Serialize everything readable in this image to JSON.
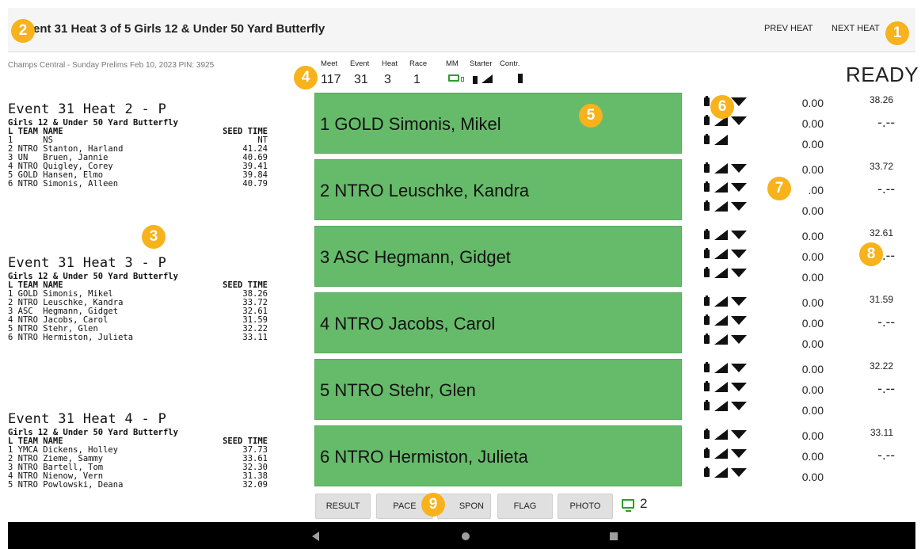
{
  "header": {
    "title": "ent 31 Heat 3 of 5 Girls 12 & Under 50 Yard Butterfly",
    "prev_label": "PREV HEAT",
    "next_label": "NEXT HEAT"
  },
  "meet_info": "Champs Central - Sunday Prelims Feb 10, 2023 PIN: 3925",
  "stats": {
    "labels": [
      "Meet",
      "Event",
      "Heat",
      "Race",
      "MM",
      "Starter",
      "Contr."
    ],
    "meet": "117",
    "event": "31",
    "heat": "3",
    "race": "1"
  },
  "status": "READY",
  "heats": [
    {
      "title": "Event 31 Heat 2 - P",
      "subtitle": "Girls 12 & Under 50 Yard Butterfly",
      "col_left": "L TEAM NAME",
      "col_right": "SEED TIME",
      "rows": [
        {
          "left": "1      NS",
          "right": "NT"
        },
        {
          "left": "2 NTRO Stanton, Harland",
          "right": "41.24"
        },
        {
          "left": "3 UN   Bruen, Jannie",
          "right": "40.69"
        },
        {
          "left": "4 NTRO Quigley, Corey",
          "right": "39.41"
        },
        {
          "left": "5 GOLD Hansen, Elmo",
          "right": "39.84"
        },
        {
          "left": "6 NTRO Simonis, Alleen",
          "right": "40.79"
        }
      ]
    },
    {
      "title": "Event 31 Heat 3 - P",
      "subtitle": "Girls 12 & Under 50 Yard Butterfly",
      "col_left": "L TEAM NAME",
      "col_right": "SEED TIME",
      "rows": [
        {
          "left": "1 GOLD Simonis, Mikel",
          "right": "38.26"
        },
        {
          "left": "2 NTRO Leuschke, Kandra",
          "right": "33.72"
        },
        {
          "left": "3 ASC  Hegmann, Gidget",
          "right": "32.61"
        },
        {
          "left": "4 NTRO Jacobs, Carol",
          "right": "31.59"
        },
        {
          "left": "5 NTRO Stehr, Glen",
          "right": "32.22"
        },
        {
          "left": "6 NTRO Hermiston, Julieta",
          "right": "33.11"
        }
      ]
    },
    {
      "title": "Event 31 Heat 4 - P",
      "subtitle": "Girls 12 & Under 50 Yard Butterfly",
      "col_left": "L TEAM NAME",
      "col_right": "SEED TIME",
      "rows": [
        {
          "left": "1 YMCA Dickens, Holley",
          "right": "37.73"
        },
        {
          "left": "2 NTRO Zieme, Sammy",
          "right": "33.61"
        },
        {
          "left": "3 NTRO Bartell, Tom",
          "right": "32.30"
        },
        {
          "left": "4 NTRO Nienow, Vern",
          "right": "31.38"
        },
        {
          "left": "5 NTRO Powlowski, Deana",
          "right": "32.09"
        }
      ]
    }
  ],
  "lanes": [
    {
      "label": "1  GOLD Simonis, Mikel",
      "seed": "38.26",
      "result": "-.--",
      "times": [
        "0.00",
        "0.00",
        "0.00"
      ]
    },
    {
      "label": "2  NTRO Leuschke, Kandra",
      "seed": "33.72",
      "result": "-.--",
      "times": [
        "0.00",
        ".00",
        "0.00"
      ]
    },
    {
      "label": "3  ASC Hegmann, Gidget",
      "seed": "32.61",
      "result": "-.--",
      "times": [
        "0.00",
        "0.00",
        "0.00"
      ]
    },
    {
      "label": "4  NTRO Jacobs, Carol",
      "seed": "31.59",
      "result": "-.--",
      "times": [
        "0.00",
        "0.00",
        "0.00"
      ]
    },
    {
      "label": "5  NTRO Stehr, Glen",
      "seed": "32.22",
      "result": "-.--",
      "times": [
        "0.00",
        "0.00",
        "0.00"
      ]
    },
    {
      "label": "6  NTRO Hermiston, Julieta",
      "seed": "33.11",
      "result": "-.--",
      "times": [
        "0.00",
        "0.00",
        "0.00"
      ]
    }
  ],
  "toolbar": {
    "result": "RESULT",
    "pace": "PACE",
    "spon": "SPON",
    "flag": "FLAG",
    "photo": "PHOTO",
    "monitor_count": "2"
  },
  "badges": [
    "1",
    "2",
    "3",
    "4",
    "5",
    "6",
    "7",
    "8",
    "9"
  ],
  "colors": {
    "lane_green": "#66bb6a",
    "badge_orange": "#f7b21c",
    "monitor_green": "#2e9e2e"
  }
}
